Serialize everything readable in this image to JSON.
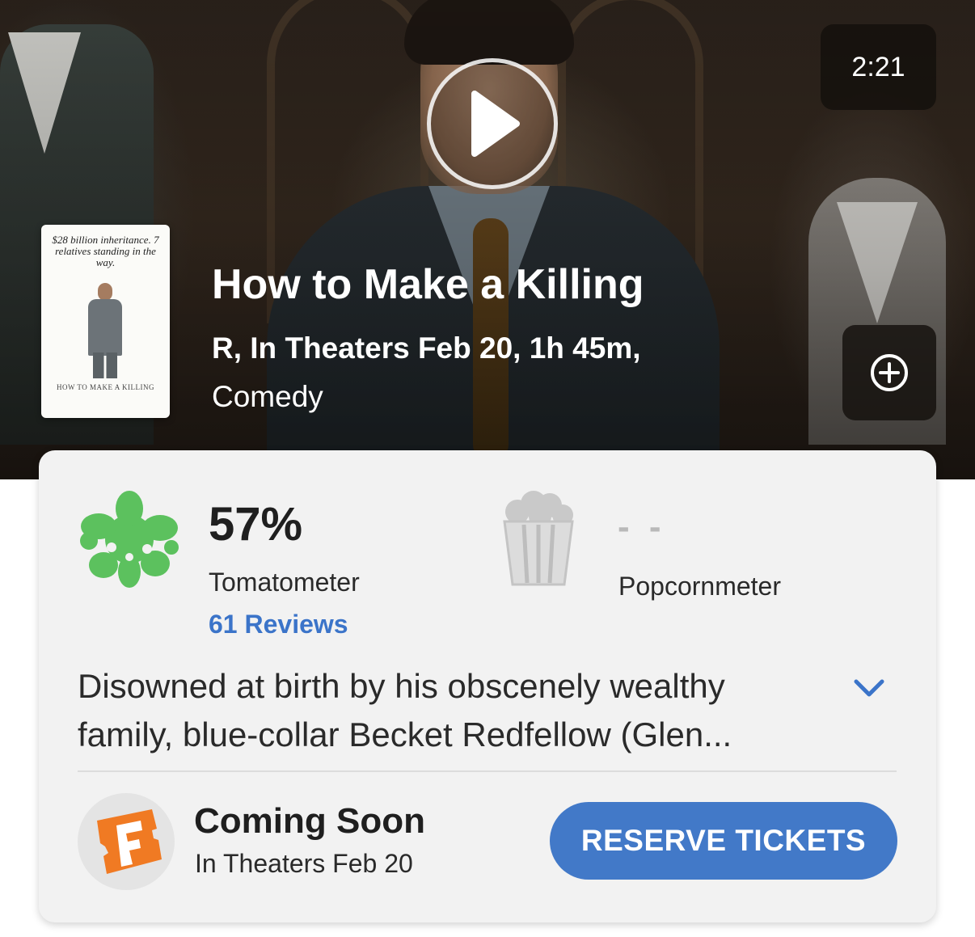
{
  "video": {
    "duration": "2:21",
    "play_icon": "play-icon"
  },
  "poster": {
    "tagline": "$28 billion inheritance. 7 relatives standing in the way.",
    "title": "HOW TO MAKE A KILLING"
  },
  "movie": {
    "title": "How to Make a Killing",
    "meta": "R, In Theaters Feb 20, 1h 45m,",
    "genre": "Comedy",
    "add_icon": "plus-circle-icon"
  },
  "scores": {
    "tomatometer": {
      "value": "57%",
      "label": "Tomatometer",
      "reviews": "61 Reviews",
      "icon": "rotten-splat-icon",
      "color": "#5cc15e"
    },
    "popcornmeter": {
      "value": "- -",
      "label": "Popcornmeter",
      "icon": "popcorn-bucket-icon",
      "color": "#b9b9b9"
    }
  },
  "synopsis": {
    "line1": "Disowned at birth by his obscenely wealthy",
    "line2": "family, blue-collar Becket Redfellow (Glen...",
    "expand_icon": "chevron-down-icon"
  },
  "tickets": {
    "status": "Coming Soon",
    "release": "In Theaters Feb 20",
    "button_label": "RESERVE TICKETS",
    "logo_icon": "fandango-logo-icon",
    "accent": "#4279c8",
    "logo_color": "#f07a23"
  }
}
